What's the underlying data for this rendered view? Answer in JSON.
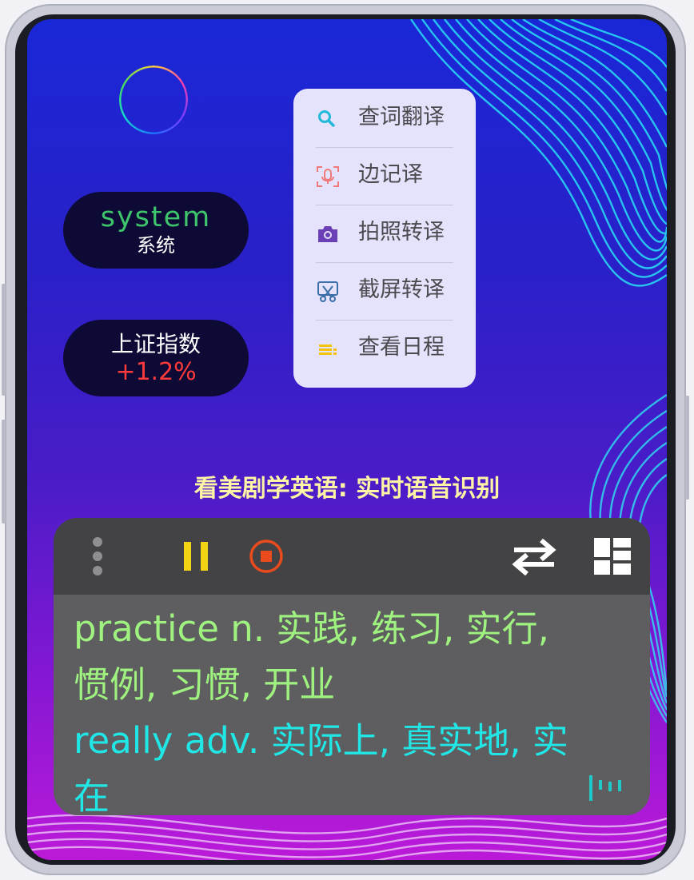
{
  "widgets": {
    "system_title": "system",
    "system_subtitle": "系统",
    "index_title": "上证指数",
    "index_change": "+1.2%"
  },
  "menu": {
    "items": [
      {
        "label": "查词翻译",
        "icon": "search-icon"
      },
      {
        "label": "边记译",
        "icon": "voice-note-icon"
      },
      {
        "label": "拍照转译",
        "icon": "camera-icon"
      },
      {
        "label": "截屏转译",
        "icon": "screenshot-scissors-icon"
      },
      {
        "label": "查看日程",
        "icon": "schedule-list-icon"
      }
    ]
  },
  "headline": "看美剧学英语:  实时语音识别",
  "panel": {
    "lines": [
      "practice  n. 实践, 练习, 实行,",
      "惯例, 习惯, 开业",
      "really  adv. 实际上, 真实地, 实",
      "在"
    ],
    "toolbar_icons": [
      "more-vertical-icon",
      "pause-icon",
      "stop-record-icon",
      "swap-icon",
      "layout-grid-icon"
    ]
  },
  "colors": {
    "dictionary_text_1": "#9ff27f",
    "dictionary_text_2": "#20e6e6",
    "accent_red": "#ff3a3a",
    "system_green": "#3ec46a"
  }
}
